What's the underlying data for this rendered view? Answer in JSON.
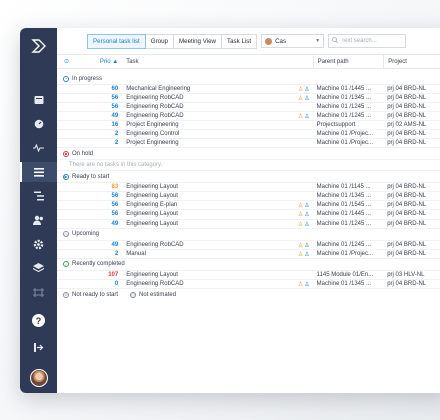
{
  "toolbar": {
    "tabs": [
      {
        "label": "Personal task list",
        "active": true
      },
      {
        "label": "Group",
        "active": false
      },
      {
        "label": "Meeting View",
        "active": false
      },
      {
        "label": "Task List",
        "active": false
      }
    ],
    "user_select": "Cas",
    "search_placeholder": "Text search..."
  },
  "columns": {
    "prio": "Prio",
    "prio_sort": "▲",
    "task": "Task",
    "parent": "Parent path",
    "project": "Project"
  },
  "groups": {
    "in_progress": {
      "label": "In progress",
      "rows": [
        {
          "prio": "60",
          "task": "Mechanical Engineering",
          "icons": true,
          "parent": "Machine 01 /1445 ...",
          "project": "prj 04 BRD-NL"
        },
        {
          "prio": "56",
          "task": "Engineering RobCAD",
          "icons": true,
          "parent": "Machine 01 /1345 ...",
          "project": "prj 04 BRD-NL"
        },
        {
          "prio": "56",
          "task": "Engineering RobCAD",
          "icons": false,
          "parent": "Machine 01 /1245 ...",
          "project": "prj 04 BRD-NL"
        },
        {
          "prio": "49",
          "task": "Engineering RobCAD",
          "icons": true,
          "parent": "Machine 01 /1245 ...",
          "project": "prj 04 BRD-NL"
        },
        {
          "prio": "16",
          "task": "Project Engineering",
          "icons": false,
          "parent": "Projectsupport",
          "project": "prj 02 AMS-NL"
        },
        {
          "prio": "2",
          "task": "Engineering Control",
          "icons": false,
          "parent": "Machine 01 /Projec...",
          "project": "prj 04 BRD-NL"
        },
        {
          "prio": "2",
          "task": "Project Engineering",
          "icons": false,
          "parent": "Machine 01 /Projec...",
          "project": "prj 04 BRD-NL"
        }
      ]
    },
    "on_hold": {
      "label": "On hold",
      "empty_text": "There are no tasks in this category."
    },
    "ready_to_start": {
      "label": "Ready to start",
      "rows": [
        {
          "prio": "83",
          "task": "Engineering Layout",
          "icons": false,
          "parent": "Machine 01 /1145 ...",
          "project": "prj 04 BRD-NL",
          "orange": true
        },
        {
          "prio": "56",
          "task": "Engineering Layout",
          "icons": false,
          "parent": "Machine 01 /1345 ...",
          "project": "prj 04 BRD-NL"
        },
        {
          "prio": "56",
          "task": "Engineering E-plan",
          "icons": true,
          "parent": "Machine 01 /1545 ...",
          "project": "prj 04 BRD-NL"
        },
        {
          "prio": "56",
          "task": "Engineering Layout",
          "icons": true,
          "parent": "Machine 01 /1445 ...",
          "project": "prj 04 BRD-NL"
        },
        {
          "prio": "49",
          "task": "Engineering Layout",
          "icons": true,
          "parent": "Machine 01 /1245 ...",
          "project": "prj 04 BRD-NL"
        }
      ]
    },
    "upcoming": {
      "label": "Upcoming",
      "rows": [
        {
          "prio": "49",
          "task": "Engineering RobCAD",
          "icons": true,
          "parent": "Machine 01 /1245 ...",
          "project": "prj 04 BRD-NL"
        },
        {
          "prio": "2",
          "task": "Manual",
          "icons": true,
          "parent": "Machine 01 /Projec...",
          "project": "prj 04 BRD-NL"
        }
      ]
    },
    "recently_completed": {
      "label": "Recently completed",
      "rows": [
        {
          "prio": "107",
          "task": "Engineering Layout",
          "icons": false,
          "parent": "1145 Module 01/En...",
          "project": "prj 03 HLV-NL",
          "red": true
        },
        {
          "prio": "0",
          "task": "Engineering RobCAD",
          "icons": true,
          "parent": "Machine 01 /1345 ...",
          "project": "prj 04 BRD-NL"
        }
      ]
    }
  },
  "footer": {
    "not_ready": "Not ready to start",
    "not_estimated": "Not estimated"
  },
  "sidebar": {
    "help": "?",
    "icons": [
      "dashboard-icon",
      "gauge-icon",
      "activity-icon",
      "list-icon",
      "hierarchy-icon",
      "users-icon",
      "settings-icon",
      "layers-icon",
      "resources-icon"
    ]
  },
  "colors": {
    "sidebar_bg": "#2f3b56",
    "accent": "#1b7fd1",
    "priority_orange": "#f29b30",
    "priority_red": "#d63b3b"
  }
}
